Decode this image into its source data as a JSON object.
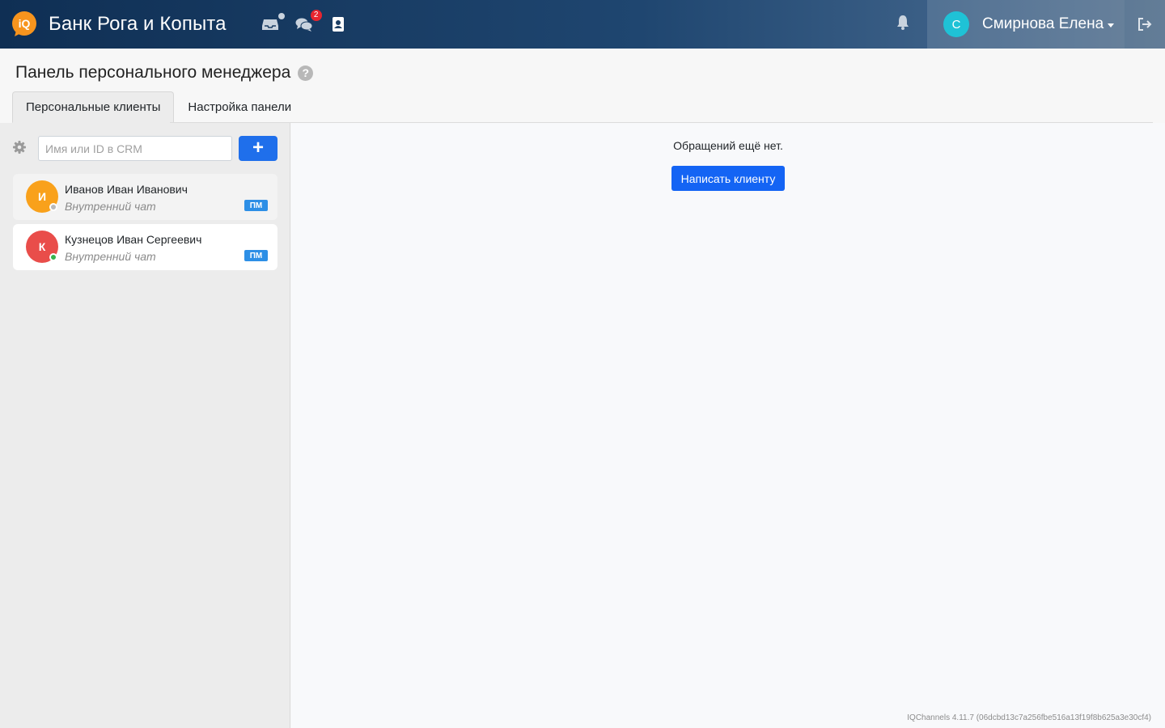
{
  "header": {
    "brand_title": "Банк Рога и Копыта",
    "logo_text": "iQ",
    "chats_badge": "2",
    "user": {
      "avatar_letter": "С",
      "name": "Смирнова Елена"
    },
    "colors": {
      "logo_orange": "#f7941d",
      "user_avatar": "#1fc2d6",
      "badge_red": "#e8252f"
    },
    "icons": [
      "inbox-icon",
      "chats-icon",
      "contacts-icon",
      "bell-icon",
      "logout-icon"
    ]
  },
  "page": {
    "title": "Панель персонального менеджера",
    "help": "?"
  },
  "tabs": [
    {
      "label": "Персональные клиенты",
      "active": true
    },
    {
      "label": "Настройка панели",
      "active": false
    }
  ],
  "sidebar": {
    "search_placeholder": "Имя или ID в CRM",
    "add_label": "+",
    "clients": [
      {
        "avatar_letter": "И",
        "avatar_color": "#f9a11b",
        "status_color": "#b9b9b9",
        "name": "Иванов Иван Иванович",
        "subtitle": "Внутренний чат",
        "tag": "ПМ"
      },
      {
        "avatar_letter": "К",
        "avatar_color": "#e94d4a",
        "status_color": "#37b24d",
        "name": "Кузнецов Иван Сергеевич",
        "subtitle": "Внутренний чат",
        "tag": "ПМ"
      }
    ]
  },
  "main": {
    "empty_message": "Обращений ещё нет.",
    "write_button": "Написать клиенту"
  },
  "footer": {
    "version": "IQChannels 4.11.7 (06dcbd13c7a256fbe516a13f19f8b625a3e30cf4)"
  }
}
